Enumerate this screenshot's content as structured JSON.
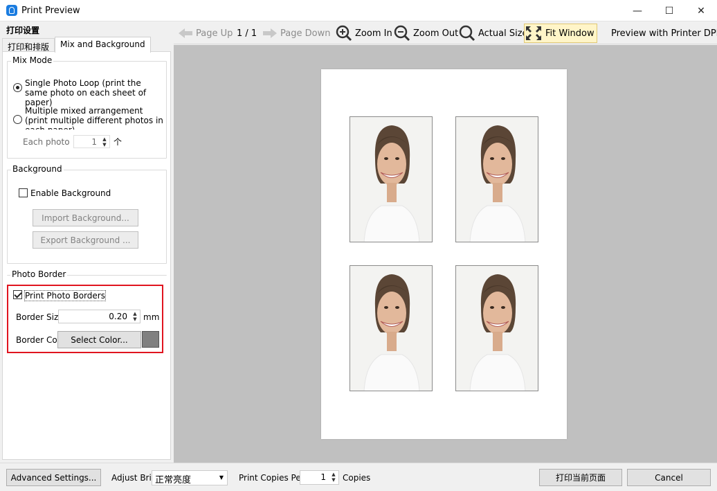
{
  "window": {
    "title": "Print Preview",
    "controls": {
      "minimize": "—",
      "maximize": "☐",
      "close": "✕"
    }
  },
  "left_panel": {
    "header": "打印设置",
    "tabs": [
      {
        "label": "打印和排版",
        "active": false
      },
      {
        "label": "Mix and Background",
        "active": true
      }
    ],
    "mix_mode": {
      "title": "Mix Mode",
      "option_single": "Single Photo Loop (print the same photo on each sheet of paper)",
      "option_single_selected": true,
      "option_multiple": "Multiple mixed arrangement (print multiple different photos in each paper)",
      "option_multiple_selected": false,
      "each_photo_label": "Each photo P",
      "each_photo_value": "1",
      "each_photo_unit": "个"
    },
    "background": {
      "title": "Background",
      "enable_label": "Enable Background",
      "enable_checked": false,
      "import_label": "Import Background...",
      "export_label": "Export Background ..."
    },
    "photo_border": {
      "title": "Photo Border",
      "print_borders_label": "Print Photo Borders",
      "print_borders_checked": true,
      "border_size_label": "Border Size",
      "border_size_value": "0.20",
      "border_size_unit": "mm",
      "border_color_label": "Border Colo",
      "select_color_label": "Select Color...",
      "color": "#808080"
    }
  },
  "toolbar": {
    "page_up": "Page Up",
    "page_indicator": "1 / 1",
    "page_down": "Page Down",
    "zoom_in": "Zoom In",
    "zoom_out": "Zoom Out",
    "actual_size": "Actual Size",
    "fit_window": "Fit Window",
    "preview_dpi": "Preview with Printer DPI"
  },
  "preview": {
    "photo_count": 4
  },
  "bottom": {
    "advanced_settings": "Advanced Settings...",
    "adjust_brightness_label": "Adjust Brig",
    "brightness_value": "正常亮度",
    "print_copies_label": "Print Copies Per",
    "copies_value": "1",
    "copies_unit": "Copies",
    "print_current_page": "打印当前页面",
    "cancel": "Cancel"
  },
  "colors": {
    "accent": "#1a7ce0",
    "highlight": "#e0141f",
    "preview_background": "#c0c0c0",
    "fit_window_active": "#fff5c8"
  }
}
